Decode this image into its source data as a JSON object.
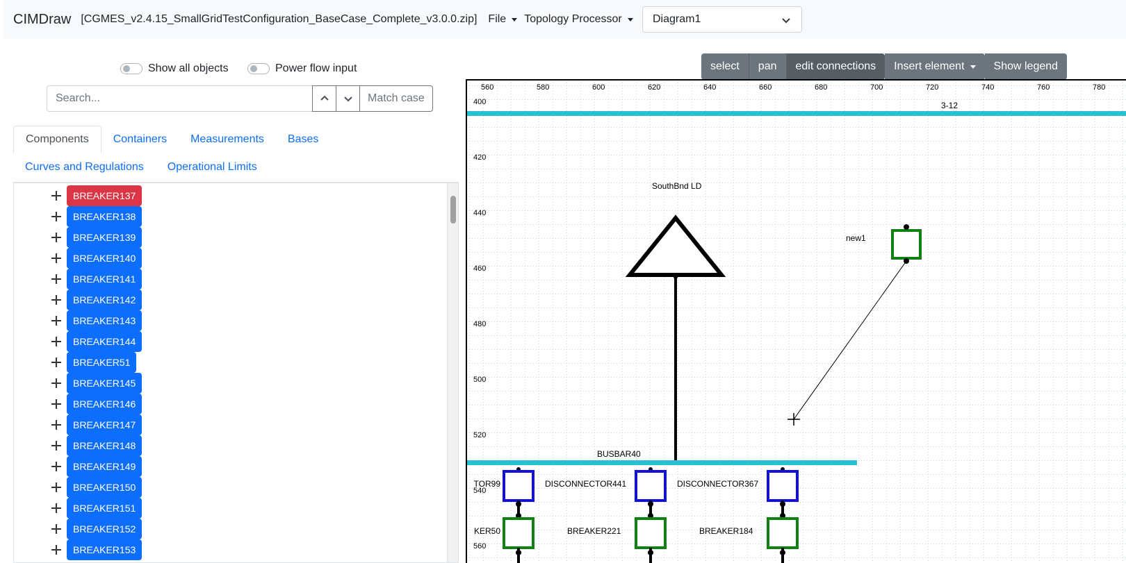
{
  "navbar": {
    "brand": "CIMDraw",
    "filename": "[CGMES_v2.4.15_SmallGridTestConfiguration_BaseCase_Complete_v3.0.0.zip]",
    "file_menu": "File",
    "topology_menu": "Topology Processor",
    "diagram_select": "Diagram1"
  },
  "toggles": {
    "show_all": "Show all objects",
    "power_flow": "Power flow input"
  },
  "search": {
    "placeholder": "Search...",
    "match_case": "Match case"
  },
  "tabs": {
    "row1": [
      "Components",
      "Containers",
      "Measurements",
      "Bases"
    ],
    "row2": [
      "Curves and Regulations",
      "Operational Limits"
    ],
    "active": "Components"
  },
  "tree": {
    "items": [
      "BREAKER137",
      "BREAKER138",
      "BREAKER139",
      "BREAKER140",
      "BREAKER141",
      "BREAKER142",
      "BREAKER143",
      "BREAKER144",
      "BREAKER51",
      "BREAKER145",
      "BREAKER146",
      "BREAKER147",
      "BREAKER148",
      "BREAKER149",
      "BREAKER150",
      "BREAKER151",
      "BREAKER152",
      "BREAKER153"
    ],
    "selected": "BREAKER137"
  },
  "toolbar": {
    "select": "select",
    "pan": "pan",
    "edit_connections": "edit connections",
    "insert_element": "Insert element",
    "show_legend": "Show legend"
  },
  "diagram": {
    "x_ticks": [
      "560",
      "580",
      "600",
      "620",
      "640",
      "660",
      "680",
      "700",
      "720",
      "740",
      "760",
      "780"
    ],
    "y_ticks": [
      "400",
      "420",
      "440",
      "460",
      "480",
      "500",
      "520",
      "540",
      "560"
    ],
    "labels": {
      "top_line": "3-12",
      "load": "SouthBnd LD",
      "new_breaker": "new1",
      "busbar": "BUSBAR40",
      "disconnector_left": "TOR99",
      "disconnector_mid": "DISCONNECTOR441",
      "disconnector_right": "DISCONNECTOR367",
      "breaker_left": "KER50",
      "breaker_mid": "BREAKER221",
      "breaker_right": "BREAKER184"
    },
    "colors": {
      "busbar": "#29c0d4",
      "disconnector": "#1010e0",
      "breaker": "#108010",
      "grid": "#7fb8c8"
    }
  }
}
